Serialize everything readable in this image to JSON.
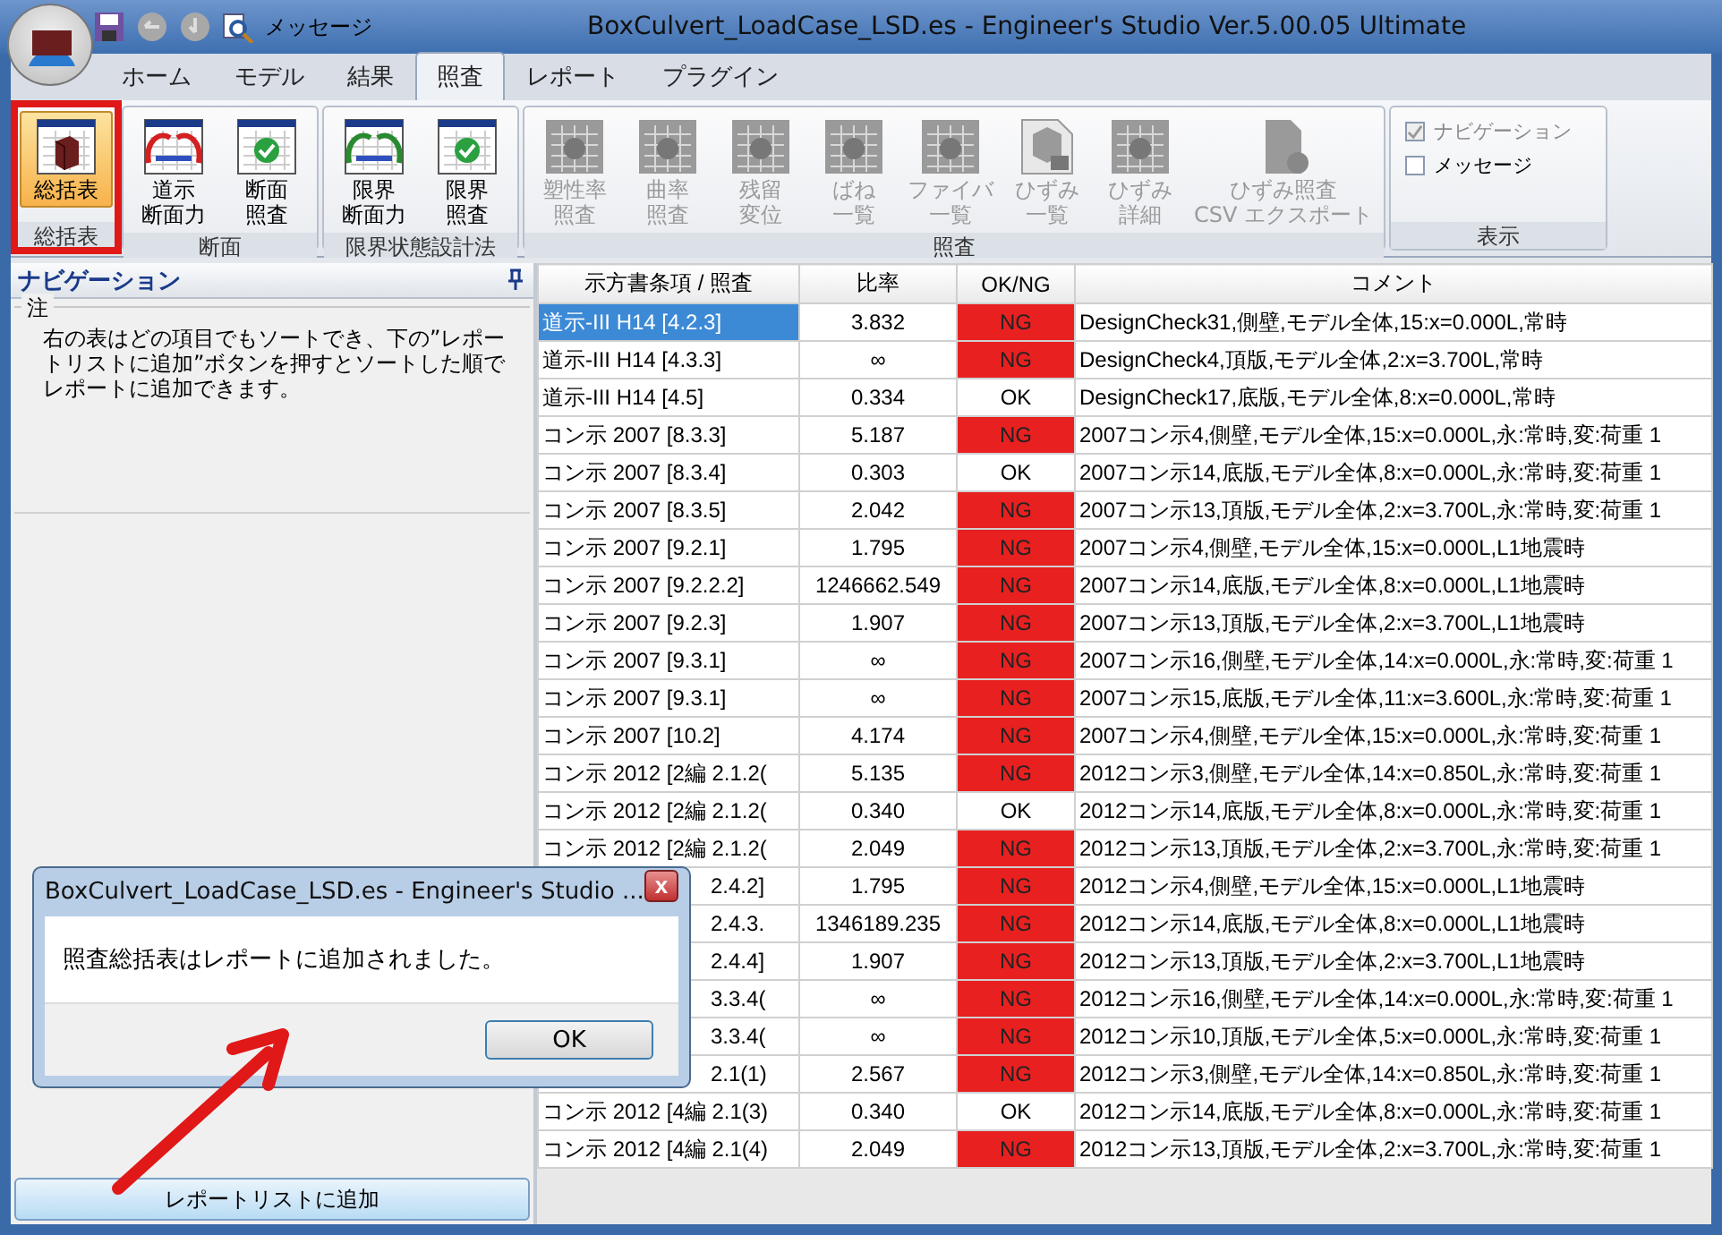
{
  "window": {
    "title": "BoxCulvert_LoadCase_LSD.es - Engineer's Studio Ver.5.00.05 Ultimate"
  },
  "quick_access": {
    "label": "メッセージ"
  },
  "tabs": [
    {
      "label": "ホーム",
      "selected": false
    },
    {
      "label": "モデル",
      "selected": false
    },
    {
      "label": "結果",
      "selected": false
    },
    {
      "label": "照査",
      "selected": true
    },
    {
      "label": "レポート",
      "selected": false
    },
    {
      "label": "プラグイン",
      "selected": false
    }
  ],
  "ribbon_groups": [
    {
      "title": "総括表",
      "buttons": [
        {
          "lines": [
            "総括表"
          ],
          "kind": "summary",
          "selected": true,
          "disabled": false
        }
      ]
    },
    {
      "title": "断面",
      "buttons": [
        {
          "lines": [
            "道示",
            "断面力"
          ],
          "kind": "force",
          "selected": false,
          "disabled": false
        },
        {
          "lines": [
            "断面",
            "照査"
          ],
          "kind": "check",
          "selected": false,
          "disabled": false
        }
      ]
    },
    {
      "title": "限界状態設計法",
      "buttons": [
        {
          "lines": [
            "限界",
            "断面力"
          ],
          "kind": "force2",
          "selected": false,
          "disabled": false
        },
        {
          "lines": [
            "限界",
            "照査"
          ],
          "kind": "check",
          "selected": false,
          "disabled": false
        }
      ]
    },
    {
      "title": "照査",
      "buttons": [
        {
          "lines": [
            "塑性率",
            "照査"
          ],
          "kind": "grid",
          "selected": false,
          "disabled": true
        },
        {
          "lines": [
            "曲率",
            "照査"
          ],
          "kind": "grid",
          "selected": false,
          "disabled": true
        },
        {
          "lines": [
            "残留",
            "変位"
          ],
          "kind": "grid",
          "selected": false,
          "disabled": true
        },
        {
          "lines": [
            "ばね",
            "一覧"
          ],
          "kind": "grid",
          "selected": false,
          "disabled": true
        },
        {
          "lines": [
            "ファイバ",
            "一覧"
          ],
          "kind": "grid",
          "selected": false,
          "disabled": true
        },
        {
          "lines": [
            "ひずみ",
            "一覧"
          ],
          "kind": "doc",
          "selected": false,
          "disabled": true
        },
        {
          "lines": [
            "ひずみ",
            "詳細"
          ],
          "kind": "grid",
          "selected": false,
          "disabled": true
        },
        {
          "lines": [
            "ひずみ照査",
            "CSV エクスポート"
          ],
          "kind": "file",
          "selected": false,
          "disabled": true
        }
      ]
    },
    {
      "title": "表示",
      "checkboxes": [
        {
          "label": "ナビゲーション",
          "checked": true,
          "disabled": true
        },
        {
          "label": "メッセージ",
          "checked": false,
          "disabled": false
        }
      ]
    }
  ],
  "navigation": {
    "title": "ナビゲーション",
    "note_title": "注",
    "note": "右の表はどの項目でもソートでき、下の”レポートリストに追加”ボタンを押すとソートした順でレポートに追加できます。",
    "button": "レポートリストに追加"
  },
  "table": {
    "columns": [
      "示方書条項 / 照査",
      "比率",
      "OK/NG",
      "コメント"
    ],
    "rows": [
      {
        "clause": "道示-III H14 [4.2.3]",
        "ratio": "3.832",
        "result": "NG",
        "fail": true,
        "comment": "DesignCheck31,側壁,モデル全体,15:x=0.000L,常時",
        "selected": true
      },
      {
        "clause": "道示-III H14 [4.3.3]",
        "ratio": "∞",
        "result": "NG",
        "fail": true,
        "comment": "DesignCheck4,頂版,モデル全体,2:x=3.700L,常時",
        "selected": false
      },
      {
        "clause": "道示-III H14 [4.5]",
        "ratio": "0.334",
        "result": "OK",
        "fail": false,
        "comment": "DesignCheck17,底版,モデル全体,8:x=0.000L,常時",
        "selected": false
      },
      {
        "clause": "コン示 2007 [8.3.3]",
        "ratio": "5.187",
        "result": "NG",
        "fail": true,
        "comment": "2007コン示4,側壁,モデル全体,15:x=0.000L,永:常時,変:荷重 1",
        "selected": false
      },
      {
        "clause": "コン示 2007 [8.3.4]",
        "ratio": "0.303",
        "result": "OK",
        "fail": false,
        "comment": "2007コン示14,底版,モデル全体,8:x=0.000L,永:常時,変:荷重 1",
        "selected": false
      },
      {
        "clause": "コン示 2007 [8.3.5]",
        "ratio": "2.042",
        "result": "NG",
        "fail": true,
        "comment": "2007コン示13,頂版,モデル全体,2:x=3.700L,永:常時,変:荷重 1",
        "selected": false
      },
      {
        "clause": "コン示 2007 [9.2.1]",
        "ratio": "1.795",
        "result": "NG",
        "fail": true,
        "comment": "2007コン示4,側壁,モデル全体,15:x=0.000L,L1地震時",
        "selected": false
      },
      {
        "clause": "コン示 2007 [9.2.2.2]",
        "ratio": "1246662.549",
        "result": "NG",
        "fail": true,
        "comment": "2007コン示14,底版,モデル全体,8:x=0.000L,L1地震時",
        "selected": false
      },
      {
        "clause": "コン示 2007 [9.2.3]",
        "ratio": "1.907",
        "result": "NG",
        "fail": true,
        "comment": "2007コン示13,頂版,モデル全体,2:x=3.700L,L1地震時",
        "selected": false
      },
      {
        "clause": "コン示 2007 [9.3.1]",
        "ratio": "∞",
        "result": "NG",
        "fail": true,
        "comment": "2007コン示16,側壁,モデル全体,14:x=0.000L,永:常時,変:荷重 1",
        "selected": false
      },
      {
        "clause": "コン示 2007 [9.3.1]",
        "ratio": "∞",
        "result": "NG",
        "fail": true,
        "comment": "2007コン示15,底版,モデル全体,11:x=3.600L,永:常時,変:荷重 1",
        "selected": false
      },
      {
        "clause": "コン示 2007 [10.2]",
        "ratio": "4.174",
        "result": "NG",
        "fail": true,
        "comment": "2007コン示4,側壁,モデル全体,15:x=0.000L,永:常時,変:荷重 1",
        "selected": false
      },
      {
        "clause": "コン示 2012 [2編 2.1.2(",
        "ratio": "5.135",
        "result": "NG",
        "fail": true,
        "comment": "2012コン示3,側壁,モデル全体,14:x=0.850L,永:常時,変:荷重 1",
        "selected": false
      },
      {
        "clause": "コン示 2012 [2編 2.1.2(",
        "ratio": "0.340",
        "result": "OK",
        "fail": false,
        "comment": "2012コン示14,底版,モデル全体,8:x=0.000L,永:常時,変:荷重 1",
        "selected": false
      },
      {
        "clause": "コン示 2012 [2編 2.1.2(",
        "ratio": "2.049",
        "result": "NG",
        "fail": true,
        "comment": "2012コン示13,頂版,モデル全体,2:x=3.700L,永:常時,変:荷重 1",
        "selected": false
      },
      {
        "clause": "2.4.2]",
        "ratio": "1.795",
        "result": "NG",
        "fail": true,
        "comment": "2012コン示4,側壁,モデル全体,15:x=0.000L,L1地震時",
        "selected": false
      },
      {
        "clause": "2.4.3.",
        "ratio": "1346189.235",
        "result": "NG",
        "fail": true,
        "comment": "2012コン示14,底版,モデル全体,8:x=0.000L,L1地震時",
        "selected": false
      },
      {
        "clause": "2.4.4]",
        "ratio": "1.907",
        "result": "NG",
        "fail": true,
        "comment": "2012コン示13,頂版,モデル全体,2:x=3.700L,L1地震時",
        "selected": false
      },
      {
        "clause": "3.3.4(",
        "ratio": "∞",
        "result": "NG",
        "fail": true,
        "comment": "2012コン示16,側壁,モデル全体,14:x=0.000L,永:常時,変:荷重 1",
        "selected": false
      },
      {
        "clause": "3.3.4(",
        "ratio": "∞",
        "result": "NG",
        "fail": true,
        "comment": "2012コン示10,頂版,モデル全体,5:x=0.000L,永:常時,変:荷重 1",
        "selected": false
      },
      {
        "clause": "2.1(1)",
        "ratio": "2.567",
        "result": "NG",
        "fail": true,
        "comment": "2012コン示3,側壁,モデル全体,14:x=0.850L,永:常時,変:荷重 1",
        "selected": false
      },
      {
        "clause": "コン示 2012 [4編 2.1(3)",
        "ratio": "0.340",
        "result": "OK",
        "fail": false,
        "comment": "2012コン示14,底版,モデル全体,8:x=0.000L,永:常時,変:荷重 1",
        "selected": false
      },
      {
        "clause": "コン示 2012 [4編 2.1(4)",
        "ratio": "2.049",
        "result": "NG",
        "fail": true,
        "comment": "2012コン示13,頂版,モデル全体,2:x=3.700L,永:常時,変:荷重 1",
        "selected": false
      }
    ]
  },
  "dialog": {
    "title": "BoxCulvert_LoadCase_LSD.es - Engineer's Studio ...",
    "close": "x",
    "message": "照査総括表はレポートに追加されました。",
    "button": "OK"
  }
}
